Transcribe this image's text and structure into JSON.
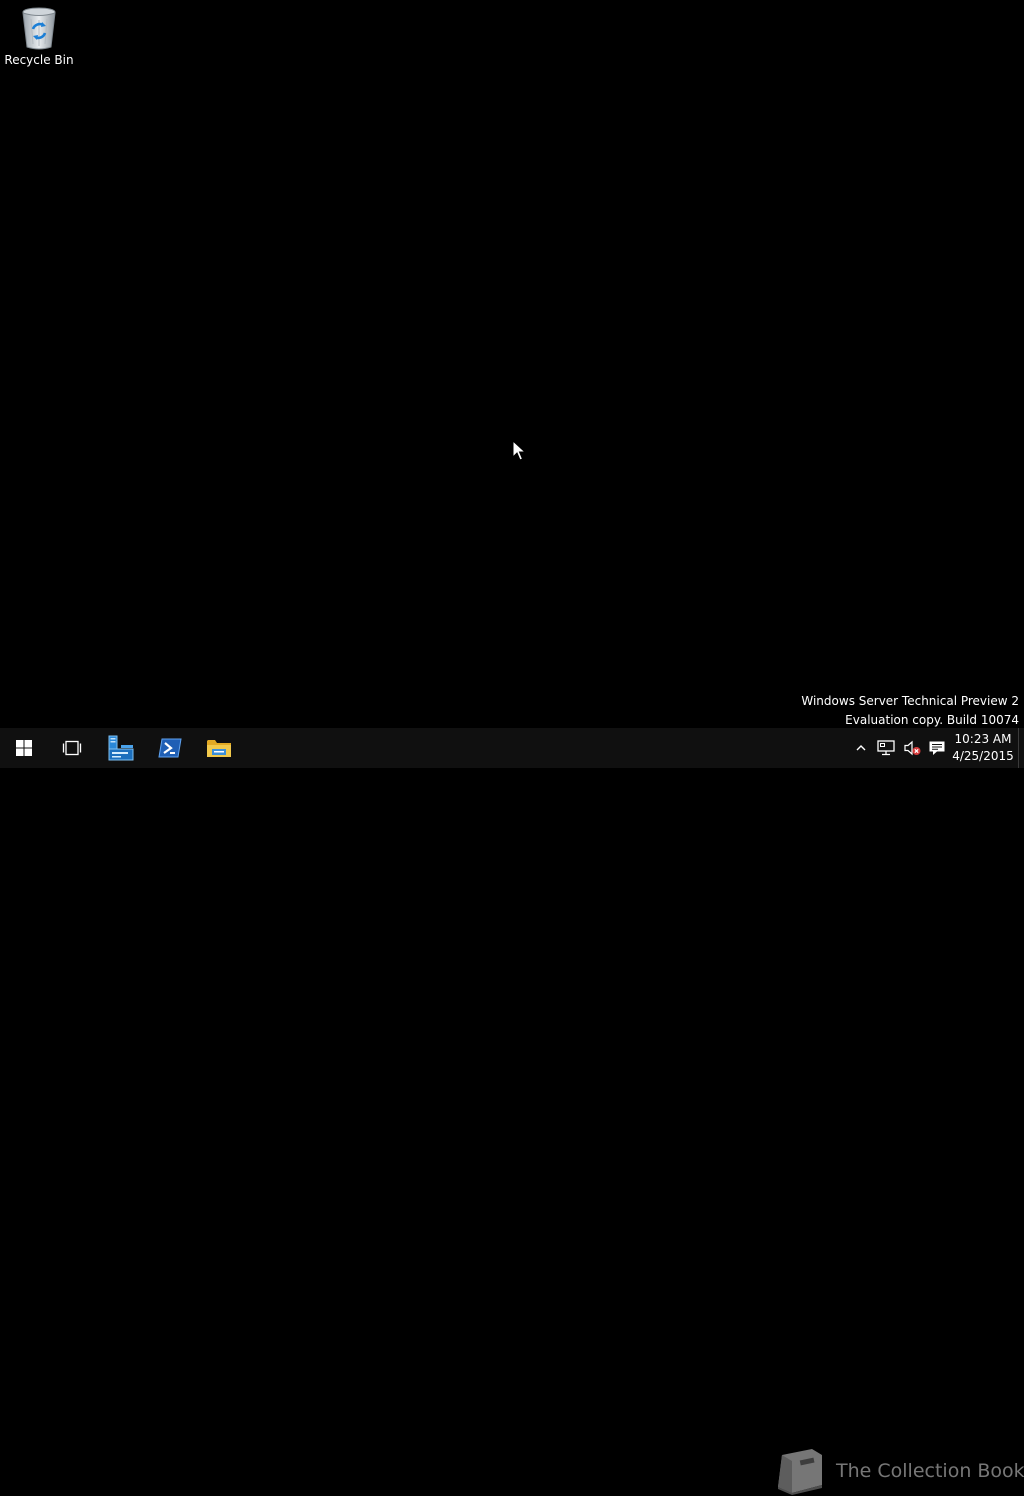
{
  "desktop": {
    "icons": [
      {
        "label": "Recycle Bin",
        "icon": "recycle-bin-icon"
      }
    ],
    "watermark": {
      "line1": "Windows Server Technical Preview 2",
      "line2": "Evaluation copy. Build 10074"
    }
  },
  "taskbar": {
    "start_icon": "windows-logo-icon",
    "pinned": [
      {
        "icon": "task-view-icon"
      },
      {
        "icon": "server-manager-icon"
      },
      {
        "icon": "powershell-icon"
      },
      {
        "icon": "file-explorer-icon"
      }
    ],
    "tray": {
      "icons": [
        "chevron-up-icon",
        "network-icon",
        "volume-muted-icon",
        "action-center-icon"
      ],
      "time": "10:23 AM",
      "date": "4/25/2015"
    }
  },
  "overlay": {
    "publisher_text": "The Collection Book",
    "publisher_icon": "book-icon"
  },
  "colors": {
    "desktop_bg": "#000000",
    "taskbar_bg": "#101010",
    "accent_blue": "#1c7fd6",
    "folder_yellow": "#f2c94c"
  }
}
